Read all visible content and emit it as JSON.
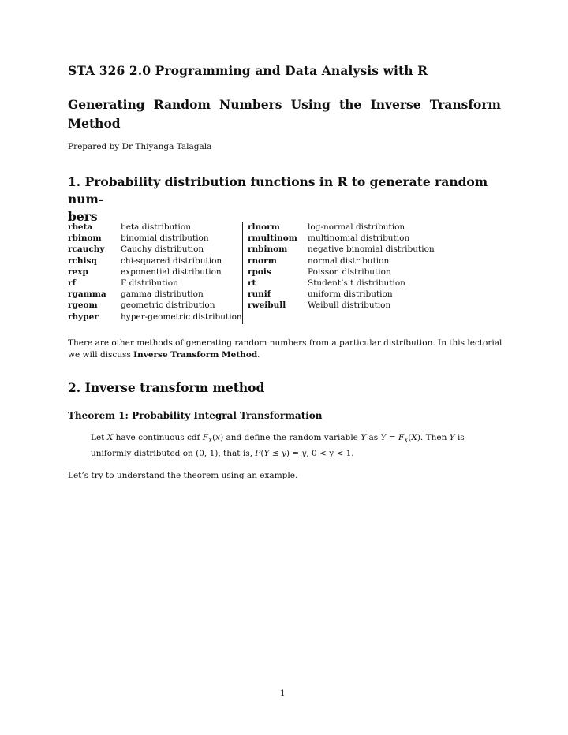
{
  "document": {
    "course_title": "STA 326 2.0 Programming and Data Analysis with R",
    "subtitle_line1_words": [
      "Generating",
      "Random",
      "Numbers",
      "Using",
      "the",
      "Inverse",
      "Transform"
    ],
    "subtitle_line2": "Method",
    "author": "Prepared by Dr Thiyanga Talagala",
    "section1": {
      "heading_line1": "1. Probability distribution functions in R to generate random num-",
      "heading_line2": "bers",
      "table_left": [
        {
          "fn": "rbeta",
          "desc": "beta distribution"
        },
        {
          "fn": "rbinom",
          "desc": "binomial distribution"
        },
        {
          "fn": "rcauchy",
          "desc": "Cauchy distribution"
        },
        {
          "fn": "rchisq",
          "desc": "chi-squared distribution"
        },
        {
          "fn": "rexp",
          "desc": "exponential distribution"
        },
        {
          "fn": "rf",
          "desc": "F distribution"
        },
        {
          "fn": "rgamma",
          "desc": "gamma distribution"
        },
        {
          "fn": "rgeom",
          "desc": "geometric distribution"
        },
        {
          "fn": "rhyper",
          "desc": "hyper-geometric distribution"
        }
      ],
      "table_right": [
        {
          "fn": "rlnorm",
          "desc": "log-normal distribution"
        },
        {
          "fn": "rmultinom",
          "desc": "multinomial distribution"
        },
        {
          "fn": "rnbinom",
          "desc": "negative binomial distribution"
        },
        {
          "fn": "rnorm",
          "desc": "normal distribution"
        },
        {
          "fn": "rpois",
          "desc": "Poisson distribution"
        },
        {
          "fn": "rt",
          "desc": "Student’s t distribution"
        },
        {
          "fn": "runif",
          "desc": "uniform distribution"
        },
        {
          "fn": "rweibull",
          "desc": "Weibull distribution"
        }
      ],
      "paragraph_pre": "There are other methods of generating random numbers from a particular distribution. In this lectorial we will discuss ",
      "paragraph_bold": "Inverse Transform Method",
      "paragraph_post": "."
    },
    "section2": {
      "heading": "2. Inverse transform method",
      "theorem_title": "Theorem 1: Probability Integral Transformation",
      "theorem_line1": "Let X have continuous cdf F_X(x) and define the random variable Y as Y = F_X(X). Then Y is",
      "theorem_line2": "uniformly distributed on (0, 1), that is, P(Y ≤ y) = y, 0 < y < 1.",
      "example_text": "Let’s try to understand the theorem using an example."
    },
    "page_number": "1"
  }
}
